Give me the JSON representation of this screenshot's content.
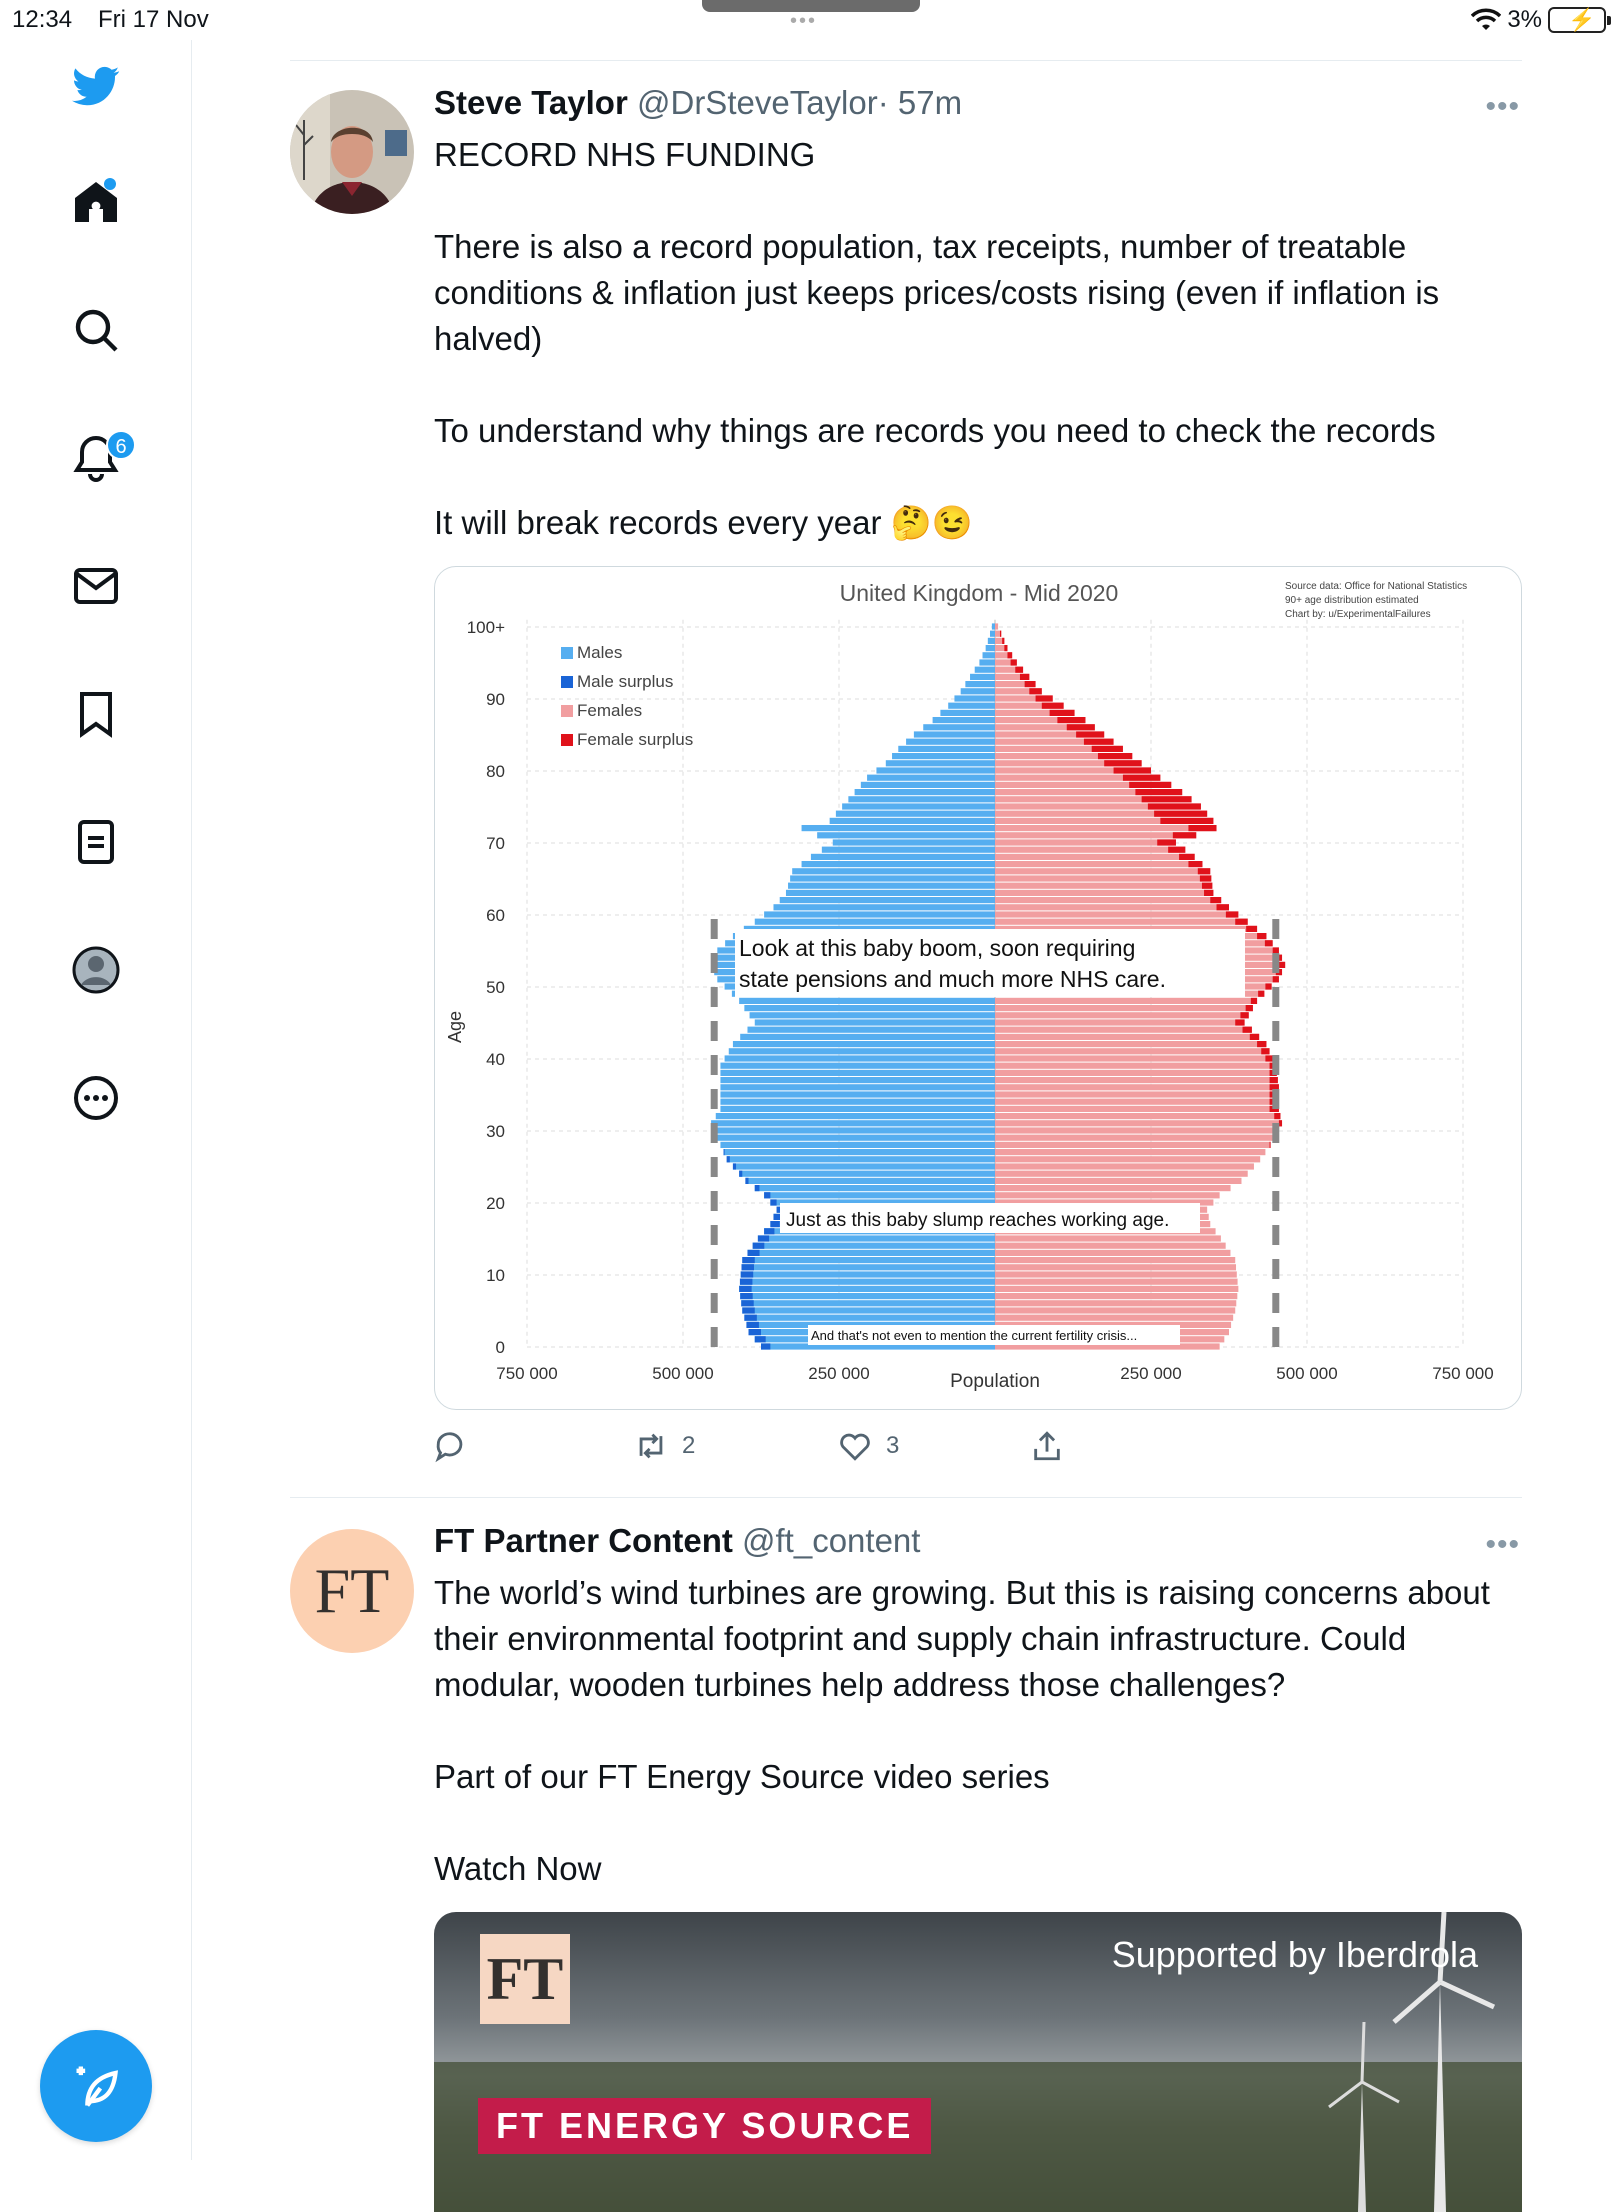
{
  "status_bar": {
    "time": "12:34",
    "date": "Fri 17 Nov",
    "battery": "3%"
  },
  "sidebar": {
    "items": [
      {
        "icon": "twitter-bird-icon"
      },
      {
        "icon": "home-icon",
        "dot": true
      },
      {
        "icon": "search-icon"
      },
      {
        "icon": "notifications-icon",
        "badge": "6"
      },
      {
        "icon": "messages-icon"
      },
      {
        "icon": "bookmarks-icon"
      },
      {
        "icon": "lists-icon"
      },
      {
        "icon": "profile-icon"
      },
      {
        "icon": "more-icon"
      }
    ],
    "compose_icon": "compose-icon",
    "accent": "#1d9bf0"
  },
  "tweet1": {
    "name": "Steve Taylor",
    "handle": "@DrSteveTaylor",
    "time": "· 57m",
    "lines": [
      "RECORD NHS FUNDING",
      "",
      "There is also a record population, tax receipts, number of treatable conditions & inflation just keeps prices/costs rising (even if inflation is halved)",
      "",
      "To understand why things are records you need to check the records",
      "",
      "It will break records every year 🤔😉"
    ],
    "actions": {
      "reply": "",
      "retweets": "2",
      "likes": "3"
    }
  },
  "chart_data": {
    "type": "bar",
    "orientation": "horizontal-population-pyramid",
    "title": "United Kingdom - Mid 2020",
    "source_note": [
      "Source data: Office for National Statistics",
      "90+ age distribution estimated",
      "Chart by: u/ExperimentalFailures"
    ],
    "xlabel": "Population",
    "ylabel": "Age",
    "y_ticks": [
      "0",
      "10",
      "20",
      "30",
      "40",
      "50",
      "60",
      "70",
      "80",
      "90",
      "100+"
    ],
    "x_ticks": [
      "750 000",
      "500 000",
      "250 000",
      "",
      "250 000",
      "500 000",
      "750 000"
    ],
    "xlim": [
      -750000,
      750000
    ],
    "legend": [
      "Males",
      "Male surplus",
      "Females",
      "Female surplus"
    ],
    "legend_position": "top-left",
    "colors": {
      "males": "#56aef0",
      "male_surplus": "#1a64d6",
      "females": "#f19ea0",
      "female_surplus": "#e0121b"
    },
    "age_points": [
      0,
      2,
      5,
      8,
      12,
      15,
      17,
      19,
      21,
      23,
      26,
      29,
      31,
      33,
      36,
      39,
      42,
      45,
      48,
      51,
      53,
      55,
      57,
      59,
      61,
      63,
      66,
      68,
      70,
      72,
      73,
      75,
      77,
      79,
      81,
      83,
      85,
      87,
      89,
      91,
      93,
      95,
      97,
      99,
      100
    ],
    "male_points": [
      375000,
      395000,
      405000,
      410000,
      405000,
      380000,
      360000,
      350000,
      370000,
      400000,
      430000,
      445000,
      455000,
      440000,
      440000,
      440000,
      420000,
      385000,
      410000,
      445000,
      455000,
      445000,
      420000,
      385000,
      355000,
      335000,
      325000,
      295000,
      260000,
      310000,
      265000,
      245000,
      225000,
      205000,
      175000,
      155000,
      130000,
      100000,
      75000,
      55000,
      40000,
      25000,
      15000,
      8000,
      5000
    ],
    "female_points": [
      360000,
      375000,
      385000,
      390000,
      385000,
      362000,
      345000,
      340000,
      360000,
      395000,
      425000,
      450000,
      460000,
      455000,
      455000,
      450000,
      435000,
      400000,
      420000,
      455000,
      465000,
      455000,
      435000,
      405000,
      375000,
      350000,
      345000,
      320000,
      290000,
      355000,
      350000,
      330000,
      300000,
      265000,
      235000,
      205000,
      175000,
      145000,
      110000,
      75000,
      55000,
      35000,
      20000,
      10000,
      5000
    ],
    "annotations": [
      "Look at this baby boom, soon requiring state pensions and much more NHS care.",
      "Just as this baby slump reaches working age.",
      "And that's not even to mention the current fertility crisis..."
    ]
  },
  "tweet2": {
    "name": "FT Partner Content",
    "handle": "@ft_content",
    "avatar_text": "FT",
    "lines": [
      "The world’s wind turbines are growing. But this is raising concerns about their environmental footprint and supply chain infrastructure. Could modular, wooden turbines help address those challenges?",
      "",
      "Part of our FT Energy Source video series",
      "",
      "Watch Now"
    ],
    "media": {
      "logo": "FT",
      "supported": "Supported by Iberdrola",
      "banner": "FT ENERGY SOURCE"
    }
  }
}
